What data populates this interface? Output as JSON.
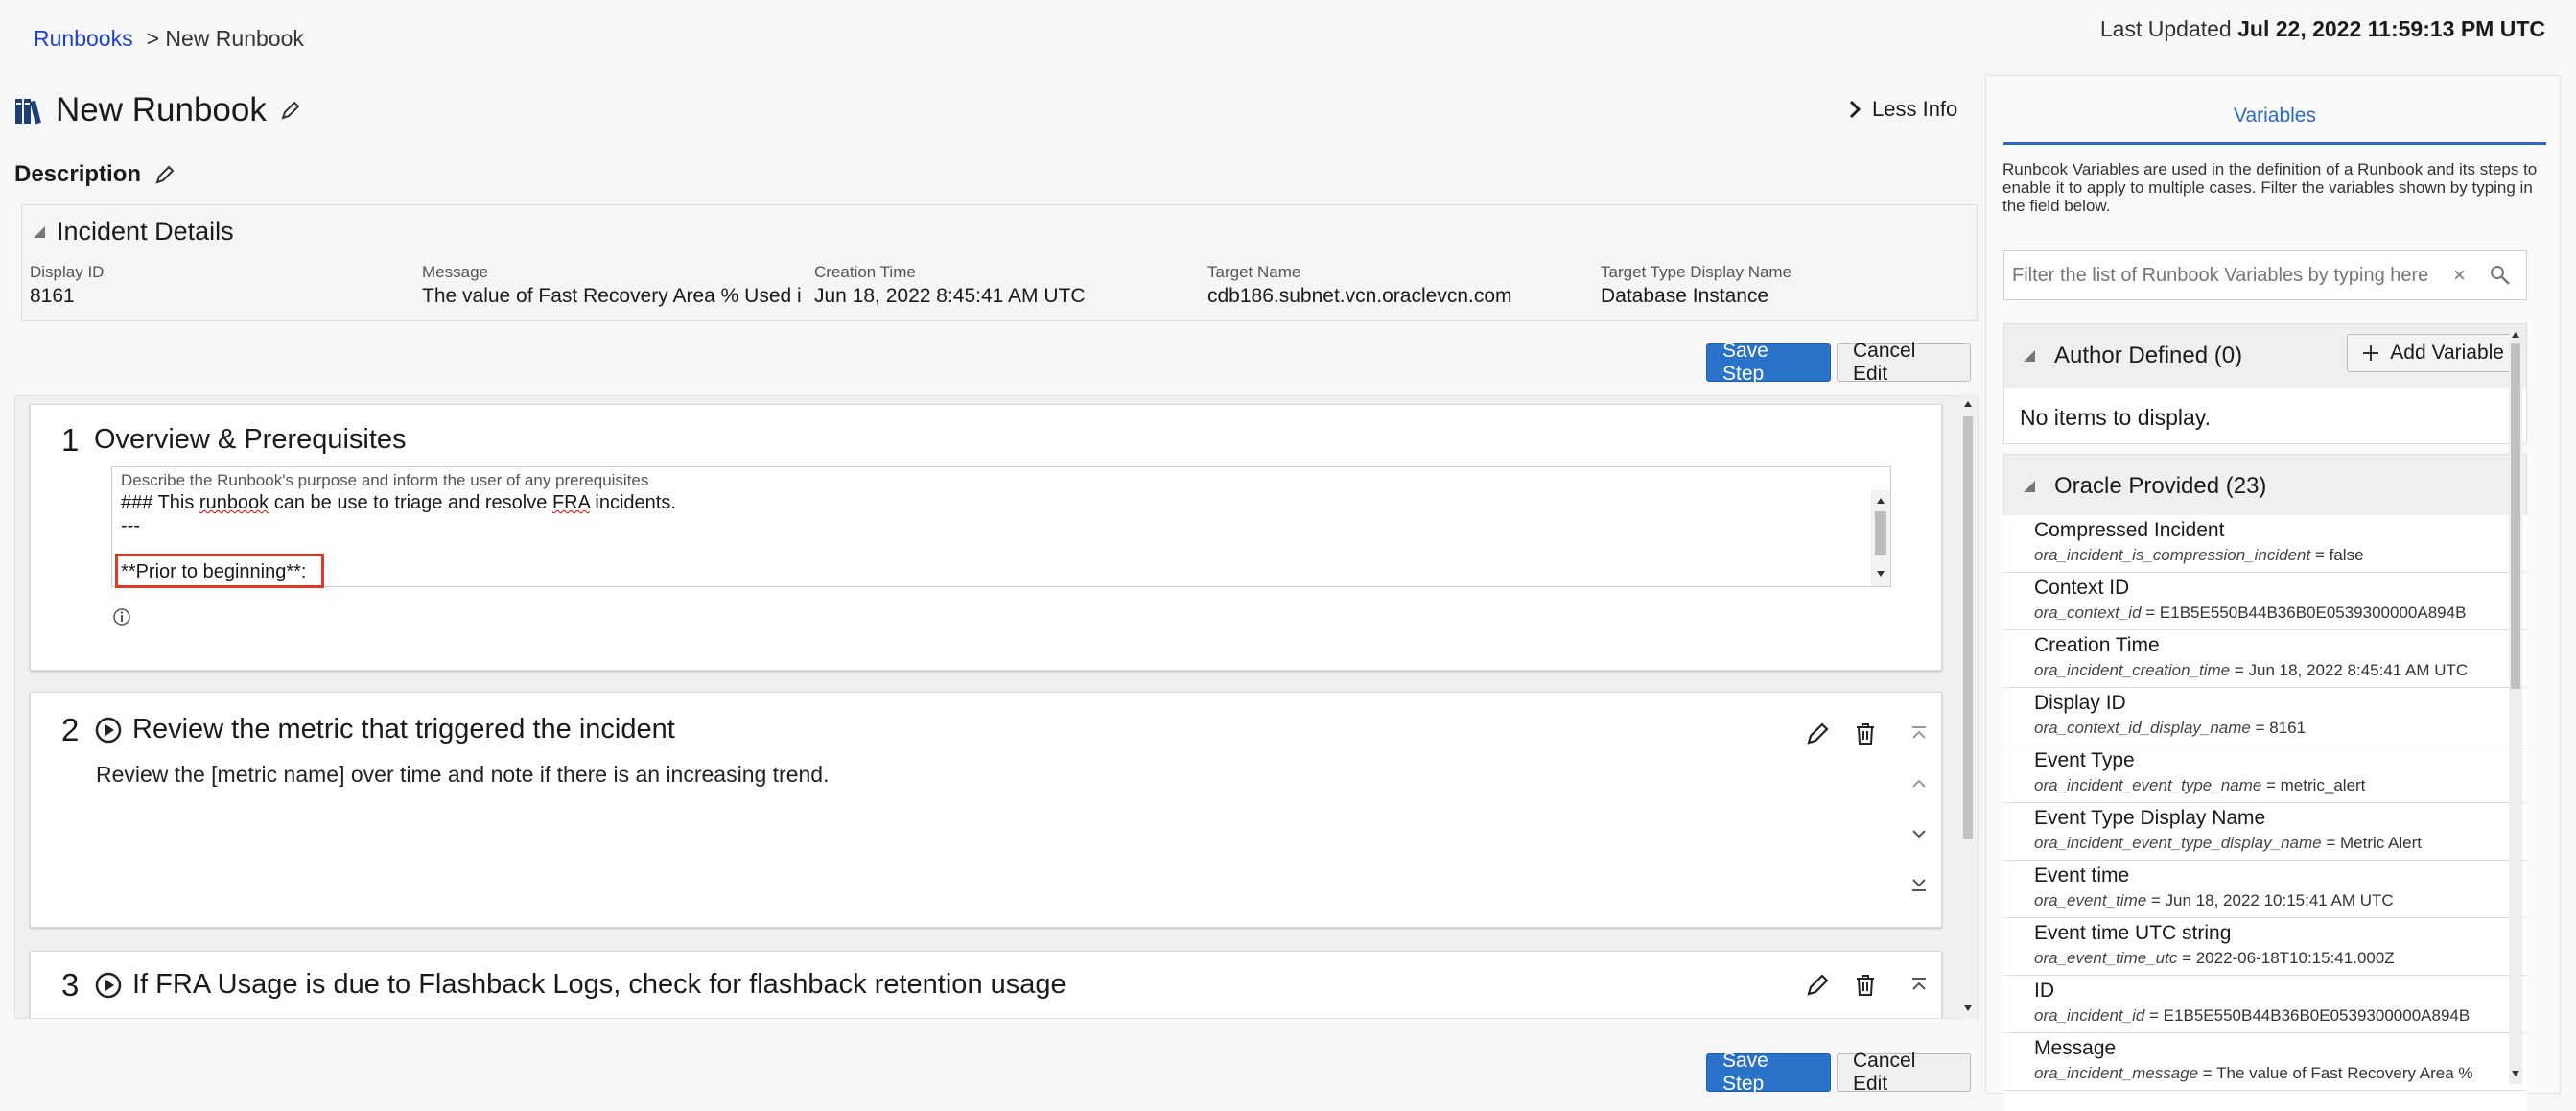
{
  "breadcrumb": {
    "root": "Runbooks",
    "current": "> New Runbook"
  },
  "last_updated": {
    "label": "Last Updated",
    "value": "Jul 22, 2022 11:59:13 PM UTC"
  },
  "title": "New Runbook",
  "less_info": "Less Info",
  "description_label": "Description",
  "incident": {
    "heading": "Incident Details",
    "fields": [
      {
        "label": "Display ID",
        "value": "8161"
      },
      {
        "label": "Message",
        "value": "The value of Fast Recovery Area % Used i"
      },
      {
        "label": "Creation Time",
        "value": "Jun 18, 2022 8:45:41 AM UTC"
      },
      {
        "label": "Target Name",
        "value": "cdb186.subnet.vcn.oraclevcn.com"
      },
      {
        "label": "Target Type Display Name",
        "value": "Database Instance"
      }
    ]
  },
  "buttons": {
    "save_step": "Save Step",
    "cancel_edit": "Cancel Edit"
  },
  "steps": [
    {
      "number": "1",
      "title": "Overview & Prerequisites",
      "editor_hint": "Describe the Runbook's purpose and inform the user of any prerequisites",
      "editor_line1_a": "### This ",
      "editor_line1_b": "runbook",
      "editor_line1_c": " can be use to triage and resolve ",
      "editor_line1_d": "FRA",
      "editor_line1_e": " incidents.",
      "editor_line2": "---",
      "editor_line3": "**Prior to beginning**:"
    },
    {
      "number": "2",
      "title": "Review the metric that triggered the incident",
      "description": "Review the [metric name] over time and note if there is an increasing trend."
    },
    {
      "number": "3",
      "title": "If FRA Usage is due to Flashback Logs, check for flashback retention usage"
    }
  ],
  "sidebar": {
    "tab": "Variables",
    "description": "Runbook Variables are used in the definition of a Runbook and its steps to enable it to apply to multiple cases. Filter the variables shown by typing in the field below.",
    "filter_placeholder": "Filter the list of Runbook Variables by typing here",
    "author_defined": "Author Defined (0)",
    "add_variable": "Add Variable",
    "no_items": "No items to display.",
    "oracle_provided": "Oracle Provided (23)",
    "variables": [
      {
        "title": "Compressed Incident",
        "key": "ora_incident_is_compression_incident",
        "value": " = false"
      },
      {
        "title": "Context ID",
        "key": "ora_context_id",
        "value": " = E1B5E550B44B36B0E0539300000A894B"
      },
      {
        "title": "Creation Time",
        "key": "ora_incident_creation_time",
        "value": " = Jun 18, 2022 8:45:41 AM UTC"
      },
      {
        "title": "Display ID",
        "key": "ora_context_id_display_name",
        "value": " = 8161"
      },
      {
        "title": "Event Type",
        "key": "ora_incident_event_type_name",
        "value": " = metric_alert"
      },
      {
        "title": "Event Type Display Name",
        "key": "ora_incident_event_type_display_name",
        "value": " = Metric Alert"
      },
      {
        "title": "Event time",
        "key": "ora_event_time",
        "value": " = Jun 18, 2022 10:15:41 AM UTC"
      },
      {
        "title": "Event time UTC string",
        "key": "ora_event_time_utc",
        "value": " = 2022-06-18T10:15:41.000Z"
      },
      {
        "title": "ID",
        "key": "ora_incident_id",
        "value": " = E1B5E550B44B36B0E0539300000A894B"
      },
      {
        "title": "Message",
        "key": "ora_incident_message",
        "value": " = The value of Fast Recovery Area %"
      }
    ]
  },
  "colors": {
    "accent": "#2a6ac0",
    "primary_button": "#2a73c8",
    "highlight_box": "#e03a22",
    "link": "#1c3fd6"
  }
}
